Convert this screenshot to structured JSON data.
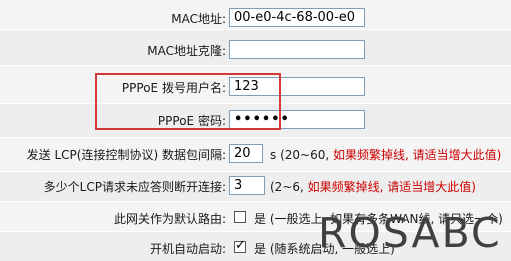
{
  "form": {
    "mac_address": {
      "label": "MAC地址:",
      "value": "00-e0-4c-68-00-e0"
    },
    "mac_clone": {
      "label": "MAC地址克隆:",
      "value": ""
    },
    "pppoe_user": {
      "label": "PPPoE 拨号用户名:",
      "value": "123"
    },
    "pppoe_password": {
      "label": "PPPoE 密码:",
      "value": "••••••"
    },
    "lcp_interval": {
      "label": "发送 LCP(连接控制协议) 数据包间隔:",
      "value": "20",
      "hint_black": "s (20~60,",
      "hint_red": "如果频繁掉线, 请适当增大此值)"
    },
    "lcp_fail": {
      "label": "多少个LCP请求未应答则断开连接:",
      "value": "3",
      "hint_black": "(2~6,",
      "hint_red": "如果频繁掉线, 请适当增大此值)"
    },
    "default_route": {
      "label": "此网关作为默认路由:",
      "checked": false,
      "option": "是 (一般选上, 如果有多条WAN线, 请只选一个)"
    },
    "auto_start": {
      "label": "开机自动启动:",
      "checked": true,
      "option": "是 (随系统启动, 一般选上)"
    }
  },
  "watermark": "ROSABC",
  "colors": {
    "accent_red": "#cc0000",
    "highlight": "#d23a3a"
  }
}
